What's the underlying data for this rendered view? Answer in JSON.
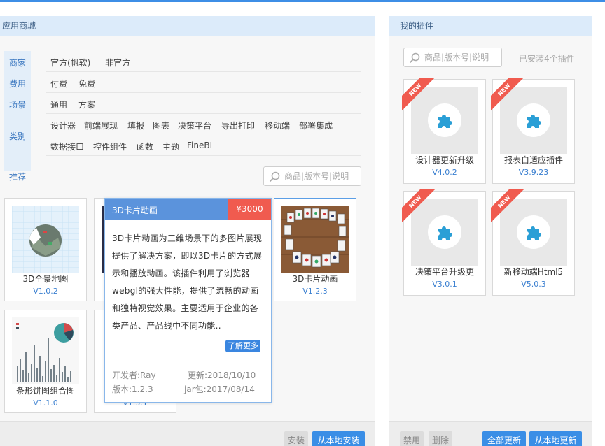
{
  "store": {
    "title": "应用商城",
    "filters": [
      {
        "label": "商家",
        "options": [
          "官方(帆软)",
          "非官方"
        ]
      },
      {
        "label": "费用",
        "options": [
          "付费",
          "免费"
        ]
      },
      {
        "label": "场景",
        "options": [
          "通用",
          "方案"
        ]
      },
      {
        "label": "类别",
        "options": [
          "设计器",
          "前端展现",
          "填报",
          "图表",
          "决策平台",
          "导出打印",
          "移动端",
          "部署集成",
          "数据接口",
          "控件组件",
          "函数",
          "主题",
          "FineBI"
        ]
      }
    ],
    "recommend_label": "推荐",
    "search_placeholder": "商品|版本号|说明",
    "cards": [
      {
        "name": "3D全景地图",
        "version": "V1.0.2"
      },
      {
        "name": "3D卡片动画",
        "version": "V1.2.3"
      },
      {
        "name": "条形饼图组合图",
        "version": "V1.1.0"
      },
      {
        "name": "",
        "version": "V1.3.1"
      }
    ],
    "popup": {
      "title": "3D卡片动画",
      "price": "¥3000",
      "description": "3D卡片动画为三维场景下的多图片展现提供了解决方案，即以3D卡片的方式展示和播放动画。该插件利用了浏览器webgl的强大性能，提供了流畅的动画和独特视觉效果。主要适用于企业的各类产品、产品线中不同功能..",
      "more": "了解更多",
      "developer": "开发者:Ray",
      "updated": "更新:2018/10/10",
      "version": "版本:1.2.3",
      "jar": "jar包:2017/08/14"
    },
    "buttons": {
      "install": "安装",
      "local_install": "从本地安装"
    }
  },
  "mine": {
    "title": "我的插件",
    "search_placeholder": "商品|版本号|说明",
    "installed_count": "已安装4个插件",
    "badge": "NEW",
    "plugins": [
      {
        "name": "设计器更新升级",
        "version": "V4.0.2"
      },
      {
        "name": "报表自适应插件",
        "version": "V3.9.23"
      },
      {
        "name": "决策平台升级更",
        "version": "V3.0.1"
      },
      {
        "name": "新移动端Html5",
        "version": "V5.0.3"
      }
    ],
    "buttons": {
      "disable": "禁用",
      "delete": "删除",
      "update_all": "全部更新",
      "local_update": "从本地更新"
    }
  },
  "colors": {
    "accent": "#3a8ee6",
    "header_bg": "#dcebfa",
    "price_red": "#f05b4f",
    "popup_header": "#5b93dc"
  }
}
